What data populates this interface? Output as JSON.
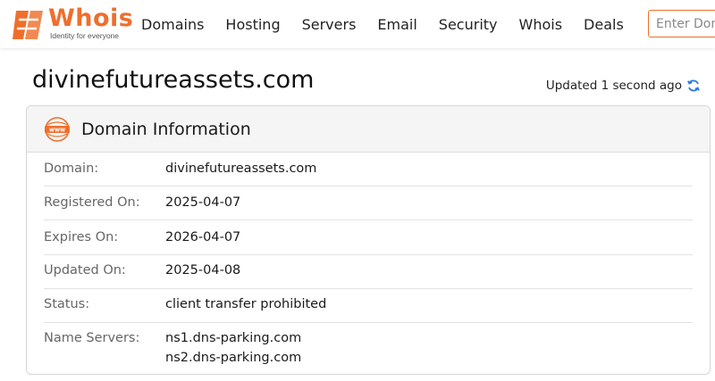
{
  "brand": {
    "name": "Whois",
    "tagline": "Identity for everyone",
    "color": "#ee6f2d"
  },
  "nav": {
    "items": [
      "Domains",
      "Hosting",
      "Servers",
      "Email",
      "Security",
      "Whois",
      "Deals"
    ]
  },
  "search": {
    "placeholder": "Enter Domain or IP"
  },
  "page": {
    "title": "divinefutureassets.com",
    "updated_text": "Updated 1 second ago"
  },
  "card": {
    "title": "Domain Information",
    "icon": "www-icon",
    "rows": [
      {
        "label": "Domain:",
        "value": "divinefutureassets.com"
      },
      {
        "label": "Registered On:",
        "value": "2025-04-07"
      },
      {
        "label": "Expires On:",
        "value": "2026-04-07"
      },
      {
        "label": "Updated On:",
        "value": "2025-04-08"
      },
      {
        "label": "Status:",
        "value": "client transfer prohibited"
      },
      {
        "label": "Name Servers:",
        "values": [
          "ns1.dns-parking.com",
          "ns2.dns-parking.com"
        ]
      }
    ]
  },
  "colors": {
    "accent": "#ee6f2d",
    "refresh": "#2b7bd6",
    "label_gray": "#666666"
  }
}
